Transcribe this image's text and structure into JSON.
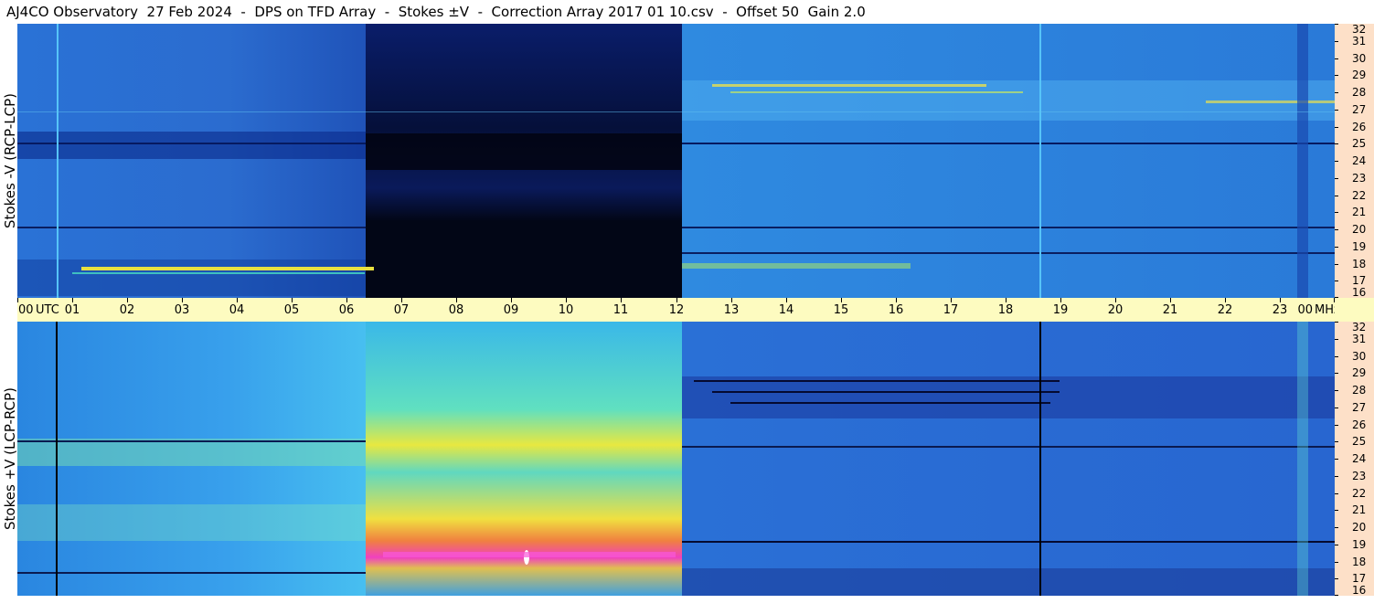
{
  "title": "AJ4CO Observatory  27 Feb 2024  -  DPS on TFD Array  -  Stokes ±V  -  Correction Array 2017 01 10.csv  -  Offset 50  Gain 2.0",
  "panels": [
    {
      "id": "top",
      "ylabel": "Stokes -V (RCP-LCP)"
    },
    {
      "id": "bottom",
      "ylabel": "Stokes +V (LCP-RCP)"
    }
  ],
  "time_axis": {
    "labels": [
      "00",
      "01",
      "02",
      "03",
      "04",
      "05",
      "06",
      "07",
      "08",
      "09",
      "10",
      "11",
      "12",
      "13",
      "14",
      "15",
      "16",
      "17",
      "18",
      "19",
      "20",
      "21",
      "22",
      "23",
      "00"
    ],
    "utc_label": "UTC",
    "unit_label": "MHz"
  },
  "freq_axis": {
    "labels": [
      "32",
      "31",
      "30",
      "29",
      "28",
      "27",
      "26",
      "25",
      "24",
      "23",
      "22",
      "21",
      "20",
      "19",
      "18",
      "17",
      "16"
    ]
  },
  "colors": {
    "background_blue": "#2a7ad8",
    "dark_blue": "#05103a",
    "light_blue": "#3aa8ee",
    "yellow": "#f2e23a",
    "magenta": "#f040c0",
    "axis_cream": "#fdfbc0",
    "axis_peach": "#fde0c8"
  }
}
